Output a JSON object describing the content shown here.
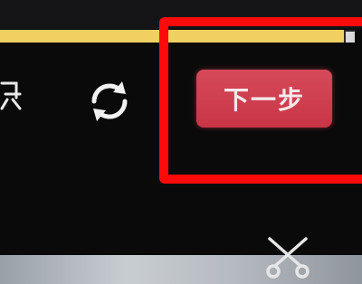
{
  "toolbar": {
    "progress": 0.97,
    "crop_icon": "crop-icon",
    "rotate_icon": "rotate-icon",
    "next_label": "下一步"
  },
  "clip": {
    "cut_icon": "scissors-icon"
  },
  "colors": {
    "accent_button": "#d0404f",
    "progress_fill": "#f2cf61",
    "highlight": "#ff0a0a",
    "background": "#0a0a0b"
  }
}
